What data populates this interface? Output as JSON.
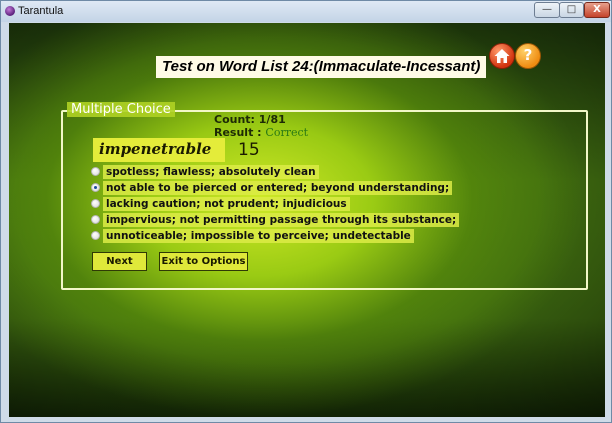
{
  "window": {
    "title": "Tarantula",
    "controls": {
      "minimize": "—",
      "maximize": "□",
      "close": "X"
    }
  },
  "header": {
    "title": "Test on Word List 24:(Immaculate-Incessant)",
    "icons": {
      "home": "home-icon",
      "help": "help-icon",
      "help_glyph": "?"
    }
  },
  "quiz": {
    "section_label": "Multiple Choice",
    "count_label": "Count: 1/81",
    "result_label": "Result",
    "result_sep": " : ",
    "result_value": "Correct",
    "word": "impenetrable",
    "question_number": "15",
    "selected_index": 1,
    "options": [
      "spotless; flawless; absolutely clean",
      "not able to be pierced or entered; beyond understanding;",
      "lacking caution; not prudent; injudicious",
      "impervious; not permitting passage through its substance;",
      "unnoticeable; impossible to perceive; undetectable"
    ],
    "buttons": {
      "next": "Next",
      "exit": "Exit to Options"
    }
  },
  "colors": {
    "accent_yellow": "#dfe83a",
    "result_green": "#2a7a14",
    "panel_border": "#f2f7c8"
  }
}
